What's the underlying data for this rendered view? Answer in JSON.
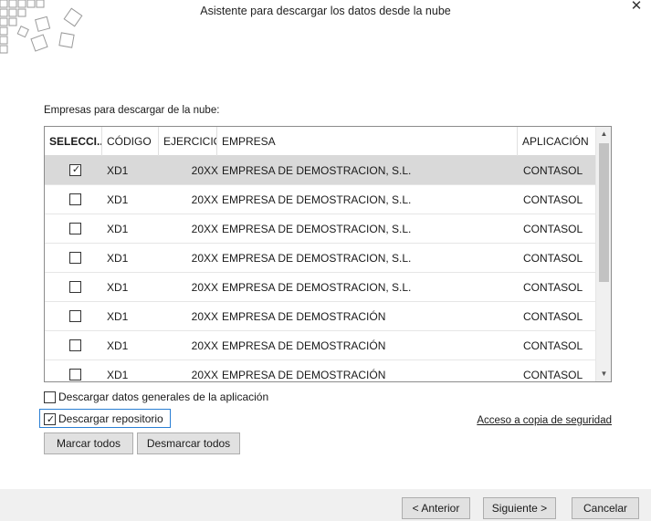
{
  "window": {
    "title": "Asistente para descargar los datos desde la nube",
    "close_glyph": "✕"
  },
  "section_label": "Empresas para descargar de la nube:",
  "grid": {
    "columns": [
      "SELECCI...",
      "CÓDIGO",
      "EJERCICIO",
      "EMPRESA",
      "APLICACIÓN"
    ],
    "rows": [
      {
        "checked": true,
        "codigo": "XD1",
        "ejercicio": "20XX",
        "empresa": "EMPRESA DE DEMOSTRACION, S.L.",
        "aplicacion": "CONTASOL"
      },
      {
        "checked": false,
        "codigo": "XD1",
        "ejercicio": "20XX",
        "empresa": "EMPRESA DE DEMOSTRACION, S.L.",
        "aplicacion": "CONTASOL"
      },
      {
        "checked": false,
        "codigo": "XD1",
        "ejercicio": "20XX",
        "empresa": "EMPRESA DE DEMOSTRACION, S.L.",
        "aplicacion": "CONTASOL"
      },
      {
        "checked": false,
        "codigo": "XD1",
        "ejercicio": "20XX",
        "empresa": "EMPRESA DE DEMOSTRACION, S.L.",
        "aplicacion": "CONTASOL"
      },
      {
        "checked": false,
        "codigo": "XD1",
        "ejercicio": "20XX",
        "empresa": "EMPRESA DE DEMOSTRACION, S.L.",
        "aplicacion": "CONTASOL"
      },
      {
        "checked": false,
        "codigo": "XD1",
        "ejercicio": "20XX",
        "empresa": "EMPRESA DE DEMOSTRACIÓN",
        "aplicacion": "CONTASOL"
      },
      {
        "checked": false,
        "codigo": "XD1",
        "ejercicio": "20XX",
        "empresa": "EMPRESA DE DEMOSTRACIÓN",
        "aplicacion": "CONTASOL"
      },
      {
        "checked": false,
        "codigo": "XD1",
        "ejercicio": "20XX",
        "empresa": "EMPRESA DE DEMOSTRACIÓN",
        "aplicacion": "CONTASOL"
      }
    ],
    "selected_row_color": "#d9d9d9"
  },
  "options": {
    "general_data_label": "Descargar datos generales de la aplicación",
    "general_data_checked": false,
    "repository_label": "Descargar repositorio",
    "repository_checked": true
  },
  "backup_link": "Acceso a copia de seguridad",
  "buttons": {
    "select_all": "Marcar todos",
    "deselect_all": "Desmarcar todos",
    "back": "< Anterior",
    "next": "Siguiente >",
    "cancel": "Cancelar"
  },
  "colors": {
    "focus": "#2a7fd4",
    "footer_bg": "#f0f0f0",
    "button_bg": "#e1e1e1"
  },
  "icons": {
    "logo": "tilted-squares-logo",
    "close": "close-icon",
    "scroll_up": "chevron-up-icon",
    "scroll_down": "chevron-down-icon",
    "checkbox": "checkmark-icon"
  }
}
